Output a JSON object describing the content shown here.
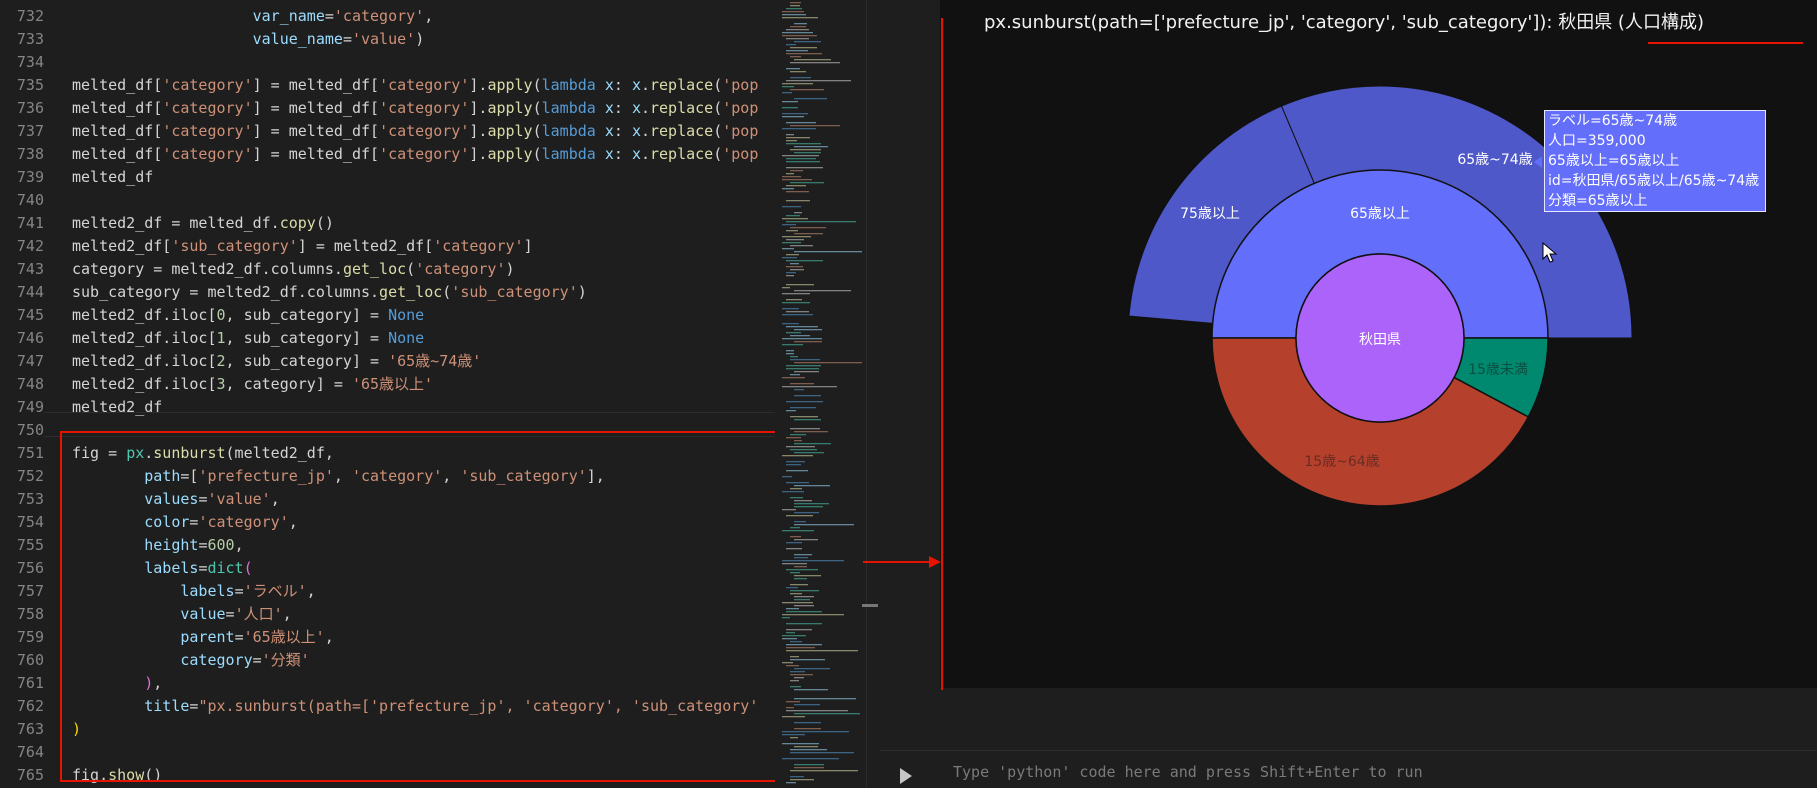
{
  "editor": {
    "lines": [
      {
        "n": "732",
        "html": "                    <span class='t-v'>var_name</span>=<span class='t-s'>'category'</span>,"
      },
      {
        "n": "733",
        "html": "                    <span class='t-v'>value_name</span>=<span class='t-s'>'value'</span>)"
      },
      {
        "n": "734",
        "html": ""
      },
      {
        "n": "735",
        "html": "melted_df[<span class='t-s'>'category'</span>] = melted_df[<span class='t-s'>'category'</span>].<span class='t-f'>apply</span>(<span class='t-k'>lambda</span> <span class='t-v'>x</span>: <span class='t-v'>x</span>.<span class='t-f'>replace</span>(<span class='t-s'>'pop</span>"
      },
      {
        "n": "736",
        "html": "melted_df[<span class='t-s'>'category'</span>] = melted_df[<span class='t-s'>'category'</span>].<span class='t-f'>apply</span>(<span class='t-k'>lambda</span> <span class='t-v'>x</span>: <span class='t-v'>x</span>.<span class='t-f'>replace</span>(<span class='t-s'>'pop</span>"
      },
      {
        "n": "737",
        "html": "melted_df[<span class='t-s'>'category'</span>] = melted_df[<span class='t-s'>'category'</span>].<span class='t-f'>apply</span>(<span class='t-k'>lambda</span> <span class='t-v'>x</span>: <span class='t-v'>x</span>.<span class='t-f'>replace</span>(<span class='t-s'>'pop</span>"
      },
      {
        "n": "738",
        "html": "melted_df[<span class='t-s'>'category'</span>] = melted_df[<span class='t-s'>'category'</span>].<span class='t-f'>apply</span>(<span class='t-k'>lambda</span> <span class='t-v'>x</span>: <span class='t-v'>x</span>.<span class='t-f'>replace</span>(<span class='t-s'>'pop</span>"
      },
      {
        "n": "739",
        "html": "melted_df"
      },
      {
        "n": "740",
        "html": ""
      },
      {
        "n": "741",
        "html": "melted2_df = melted_df.<span class='t-f'>copy</span>()"
      },
      {
        "n": "742",
        "html": "melted2_df[<span class='t-s'>'sub_category'</span>] = melted2_df[<span class='t-s'>'category'</span>]"
      },
      {
        "n": "743",
        "html": "category = melted2_df.columns.<span class='t-f'>get_loc</span>(<span class='t-s'>'category'</span>)"
      },
      {
        "n": "744",
        "html": "sub_category = melted2_df.columns.<span class='t-f'>get_loc</span>(<span class='t-s'>'sub_category'</span>)"
      },
      {
        "n": "745",
        "html": "melted2_df.iloc[<span class='t-n'>0</span>, sub_category] = <span class='t-k'>None</span>"
      },
      {
        "n": "746",
        "html": "melted2_df.iloc[<span class='t-n'>1</span>, sub_category] = <span class='t-k'>None</span>"
      },
      {
        "n": "747",
        "html": "melted2_df.iloc[<span class='t-n'>2</span>, sub_category] = <span class='t-s'>'65歳~74歳'</span>"
      },
      {
        "n": "748",
        "html": "melted2_df.iloc[<span class='t-n'>3</span>, category] = <span class='t-s'>'65歳以上'</span>"
      },
      {
        "n": "749",
        "html": "melted2_df"
      },
      {
        "n": "750",
        "html": ""
      },
      {
        "n": "751",
        "html": "fig = <span class='t-c'>px</span>.<span class='t-f'>sunburst</span>(melted2_df,"
      },
      {
        "n": "752",
        "html": "        <span class='t-v'>path</span>=[<span class='t-s'>'prefecture_jp'</span>, <span class='t-s'>'category'</span>, <span class='t-s'>'sub_category'</span>],"
      },
      {
        "n": "753",
        "html": "        <span class='t-v'>values</span>=<span class='t-s'>'value'</span>,"
      },
      {
        "n": "754",
        "html": "        <span class='t-v'>color</span>=<span class='t-s'>'category'</span>,"
      },
      {
        "n": "755",
        "html": "        <span class='t-v'>height</span>=<span class='t-n'>600</span>,"
      },
      {
        "n": "756",
        "html": "        <span class='t-v'>labels</span>=<span class='t-c'>dict</span><span class='t-p'>(</span>"
      },
      {
        "n": "757",
        "html": "            <span class='t-v'>labels</span>=<span class='t-s'>'ラベル'</span>,"
      },
      {
        "n": "758",
        "html": "            <span class='t-v'>value</span>=<span class='t-s'>'人口'</span>,"
      },
      {
        "n": "759",
        "html": "            <span class='t-v'>parent</span>=<span class='t-s'>'65歳以上'</span>,"
      },
      {
        "n": "760",
        "html": "            <span class='t-v'>category</span>=<span class='t-s'>'分類'</span>"
      },
      {
        "n": "761",
        "html": "        <span class='t-p'>)</span>,"
      },
      {
        "n": "762",
        "html": "        <span class='t-v'>title</span>=<span class='t-s'>\"px.sunburst(path=['prefecture_jp', 'category', 'sub_category'</span>"
      },
      {
        "n": "763",
        "html": "<span class='t-b'>)</span>"
      },
      {
        "n": "764",
        "html": ""
      },
      {
        "n": "765",
        "html": "fig.<span class='t-f'>show</span>()"
      }
    ]
  },
  "figure": {
    "title": "px.sunburst(path=['prefecture_jp', 'category', 'sub_category']): 秋田県 (人口構成)",
    "root_label": "秋田県",
    "labels": {
      "over65": "65歳以上",
      "over75": "75歳以上",
      "age65_74": "65歳~74歳",
      "age15_64": "15歳~64歳",
      "under15": "15歳未満"
    },
    "colors": {
      "root": "#ab63fa",
      "over65": "#636efa",
      "over65_outer": "#4f58c8",
      "age15_64": "#b5412c",
      "under15": "#00896e",
      "background": "#111111"
    },
    "tooltip": {
      "line1": "ラベル=65歳~74歳",
      "line2": "人口=359,000",
      "line3": "65歳以上=65歳以上",
      "line4": "id=秋田県/65歳以上/65歳~74歳",
      "line5": "分類=65歳以上"
    }
  },
  "input": {
    "placeholder": "Type 'python' code here and press Shift+Enter to run"
  }
}
